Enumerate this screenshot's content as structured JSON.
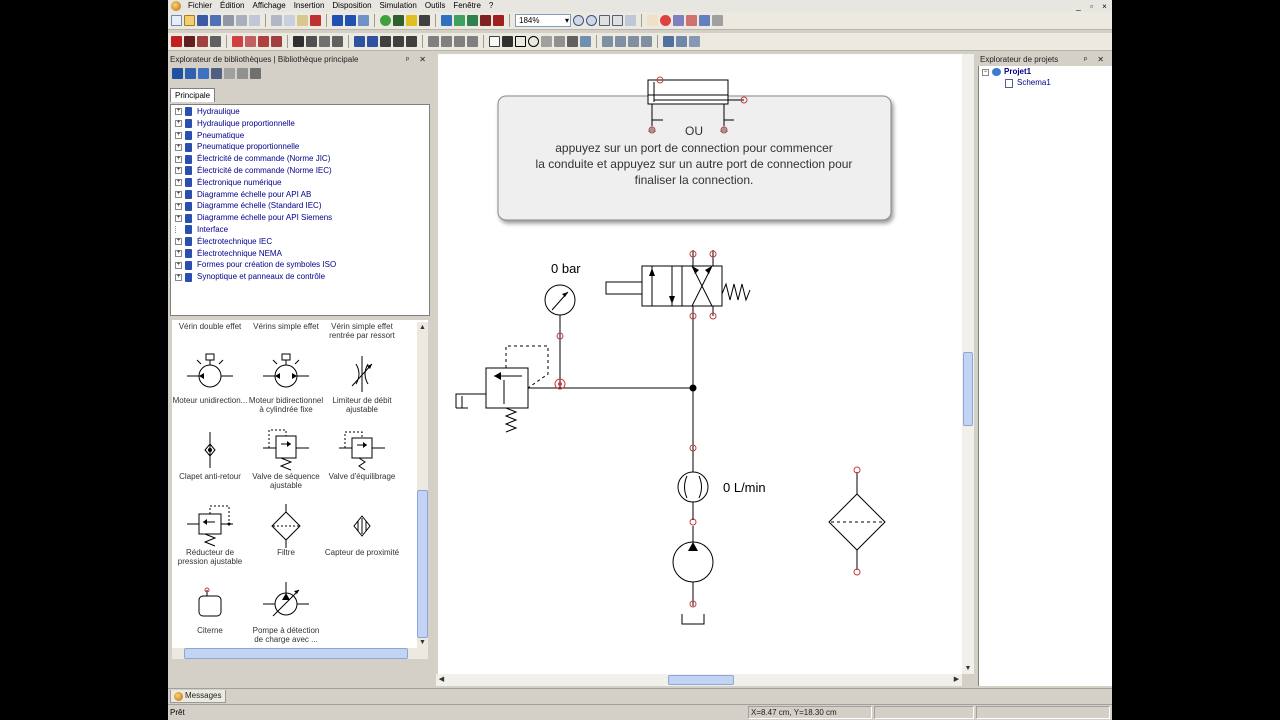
{
  "menu": {
    "items": [
      "Fichier",
      "Édition",
      "Affichage",
      "Insertion",
      "Disposition",
      "Simulation",
      "Outils",
      "Fenêtre",
      "?"
    ],
    "window_controls": [
      "_",
      "▫",
      "×"
    ]
  },
  "toolbar": {
    "zoom_value": "184%"
  },
  "library_panel": {
    "title": "Explorateur de bibliothèques | Bibliothèque principale",
    "tab_label": "Principale",
    "tree_items": [
      "Hydraulique",
      "Hydraulique proportionnelle",
      "Pneumatique",
      "Pneumatique proportionnelle",
      "Électricité de commande (Norme JIC)",
      "Électricité de commande (Norme IEC)",
      "Électronique numérique",
      "Diagramme échelle pour API AB",
      "Diagramme échelle (Standard IEC)",
      "Diagramme échelle pour API Siemens",
      "Interface",
      "Électrotechnique IEC",
      "Électrotechnique NEMA",
      "Formes pour création de symboles ISO",
      "Synoptique et panneaux de contrôle"
    ],
    "palette_headers": [
      "Vérin double effet",
      "Vérins simple effet",
      "Vérin simple effet rentrée par ressort"
    ],
    "palette_items": [
      {
        "label": "Moteur unidirection...",
        "icon": "motor-uni-icon"
      },
      {
        "label": "Moteur bidirectionnel à cylindrée fixe",
        "icon": "motor-bi-icon"
      },
      {
        "label": "Limiteur de débit ajustable",
        "icon": "flow-limiter-icon"
      },
      {
        "label": "Clapet anti-retour",
        "icon": "check-valve-icon"
      },
      {
        "label": "Valve de séquence ajustable",
        "icon": "sequence-valve-icon"
      },
      {
        "label": "Valve d'équilibrage",
        "icon": "balancing-valve-icon"
      },
      {
        "label": "Réducteur de pression ajustable",
        "icon": "pressure-reducer-icon"
      },
      {
        "label": "Filtre",
        "icon": "filter-icon"
      },
      {
        "label": "Capteur de proximité",
        "icon": "proximity-sensor-icon"
      },
      {
        "label": "Citerne",
        "icon": "tank-icon"
      },
      {
        "label": "Pompe à détection de charge avec ...",
        "icon": "load-sensing-pump-icon"
      }
    ]
  },
  "canvas": {
    "tooltip": {
      "or_label": "OU",
      "line1": "appuyez sur un port de connection pour commencer",
      "line2": "la conduite et appuyez sur un autre port de connection pour",
      "line3": "finaliser la connection."
    },
    "pressure_label": "0 bar",
    "flow_label": "0 L/min"
  },
  "project_panel": {
    "title": "Explorateur de projets",
    "project": "Projet1",
    "schema": "Schema1"
  },
  "bottom": {
    "messages_tab": "Messages",
    "status_text": "Prêt",
    "coords": "X=8.47 cm, Y=18.30 cm"
  }
}
